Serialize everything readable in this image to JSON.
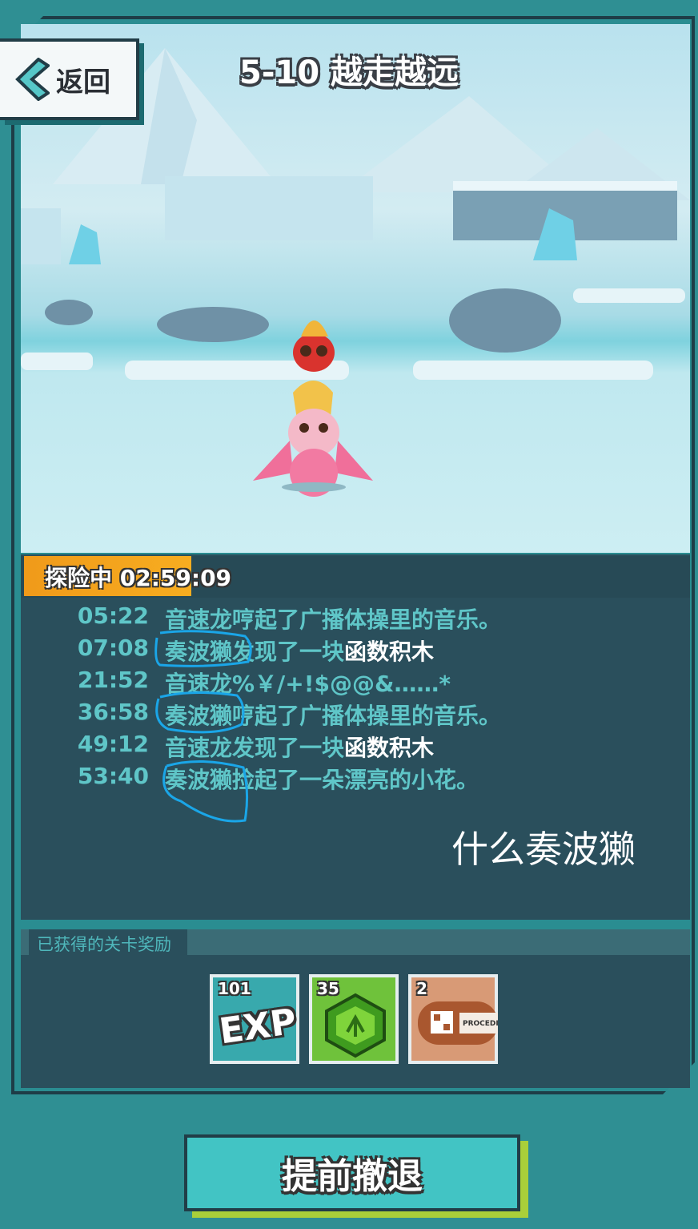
{
  "header": {
    "back_label": "返回",
    "title": "5-10 越走越远"
  },
  "status": {
    "label": "探险中 02:59:09",
    "progress": 0.25
  },
  "log": [
    {
      "time": "05:22",
      "pre": "音速龙哼起了广播体操里的音乐。",
      "highlight": ""
    },
    {
      "time": "07:08",
      "pre": "奏波獭发现了一块",
      "highlight": "函数积木"
    },
    {
      "time": "21:52",
      "pre": "音速龙%￥/+!$@@&……*",
      "highlight": ""
    },
    {
      "time": "36:58",
      "pre": "奏波獭哼起了广播体操里的音乐。",
      "highlight": ""
    },
    {
      "time": "49:12",
      "pre": "音速龙发现了一块",
      "highlight": "函数积木"
    },
    {
      "time": "53:40",
      "pre": "奏波獭捡起了一朵漂亮的小花。",
      "highlight": ""
    }
  ],
  "annotation": "什么奏波獭",
  "rewards": {
    "label": "已获得的关卡奖励",
    "items": [
      {
        "icon": "exp-icon",
        "count": "101",
        "text": "EXP"
      },
      {
        "icon": "green-gem-icon",
        "count": "35"
      },
      {
        "icon": "procedure-chip-icon",
        "count": "2",
        "text": "PROCEDI"
      }
    ]
  },
  "retreat_label": "提前撤退",
  "colors": {
    "accent_teal": "#42c4c4",
    "panel": "#2a4f5c",
    "log_text": "#5fc6c8",
    "progress": "#f7ad20"
  }
}
